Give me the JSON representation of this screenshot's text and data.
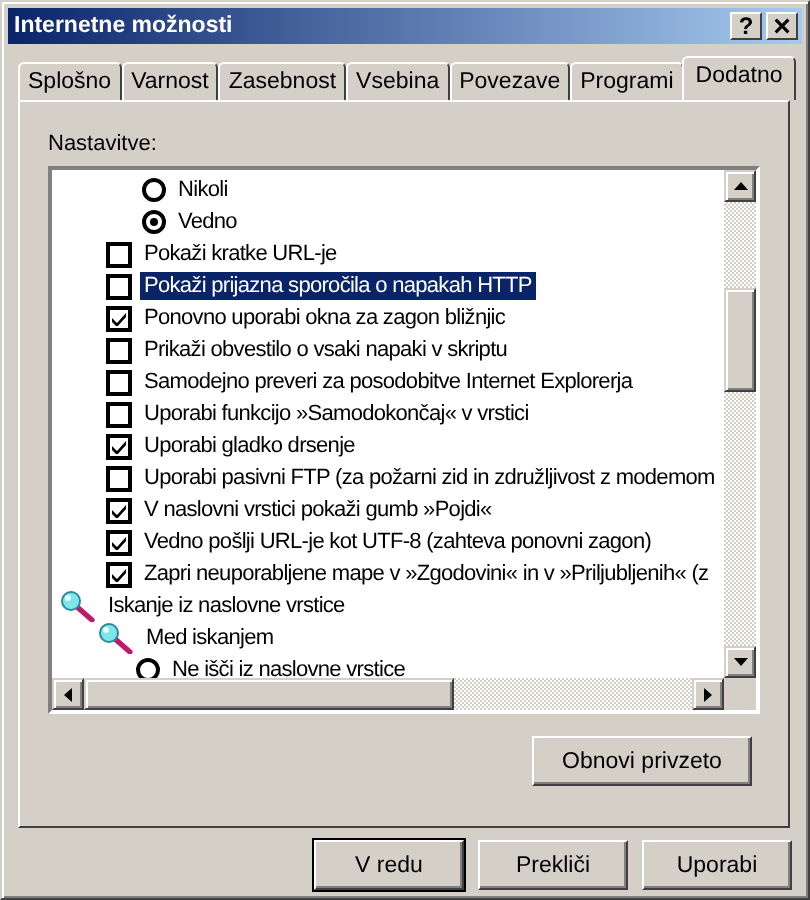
{
  "window": {
    "title": "Internetne možnosti",
    "title_buttons": [
      {
        "kind": "help",
        "label": "?"
      },
      {
        "kind": "close",
        "label": "×"
      }
    ]
  },
  "tabs": [
    {
      "label": "Splošno",
      "selected": false
    },
    {
      "label": "Varnost",
      "selected": false
    },
    {
      "label": "Zasebnost",
      "selected": false
    },
    {
      "label": "Vsebina",
      "selected": false
    },
    {
      "label": "Povezave",
      "selected": false
    },
    {
      "label": "Programi",
      "selected": false
    },
    {
      "label": "Dodatno",
      "selected": true
    }
  ],
  "settings_label": "Nastavitve:",
  "settings": [
    {
      "kind": "radio",
      "label": "Nikoli",
      "checked": false,
      "selected": false
    },
    {
      "kind": "radio",
      "label": "Vedno",
      "checked": true,
      "selected": false
    },
    {
      "kind": "checkbox",
      "label": "Pokaži kratke URL-je",
      "checked": false,
      "selected": false
    },
    {
      "kind": "checkbox",
      "label": "Pokaži prijazna sporočila o napakah HTTP",
      "checked": false,
      "selected": true
    },
    {
      "kind": "checkbox",
      "label": "Ponovno uporabi okna za zagon bližnjic",
      "checked": true,
      "selected": false
    },
    {
      "kind": "checkbox",
      "label": "Prikaži obvestilo o vsaki napaki v skriptu",
      "checked": false,
      "selected": false
    },
    {
      "kind": "checkbox",
      "label": "Samodejno preveri za posodobitve Internet Explorerja",
      "checked": false,
      "selected": false
    },
    {
      "kind": "checkbox",
      "label": "Uporabi funkcijo »Samodokončaj« v vrstici",
      "checked": false,
      "selected": false
    },
    {
      "kind": "checkbox",
      "label": "Uporabi gladko drsenje",
      "checked": true,
      "selected": false
    },
    {
      "kind": "checkbox",
      "label": "Uporabi pasivni FTP (za požarni zid in združljivost z modemom",
      "checked": false,
      "selected": false
    },
    {
      "kind": "checkbox",
      "label": "V naslovni vrstici pokaži gumb »Pojdi«",
      "checked": true,
      "selected": false
    },
    {
      "kind": "checkbox",
      "label": "Vedno pošlji URL-je kot UTF-8 (zahteva ponovni zagon)",
      "checked": true,
      "selected": false
    },
    {
      "kind": "checkbox",
      "label": "Zapri neuporabljene mape v »Zgodovini« in v »Priljubljenih« (z",
      "checked": true,
      "selected": false
    },
    {
      "kind": "group",
      "label": "Iskanje iz naslovne vrstice",
      "selected": false,
      "children": [
        {
          "kind": "group",
          "label": "Med iskanjem",
          "selected": false,
          "children": [
            {
              "kind": "radio",
              "label": "Ne išči iz naslovne vrstice",
              "checked": false,
              "selected": false
            }
          ]
        }
      ]
    }
  ],
  "restore_button": "Obnovi privzeto",
  "buttons": [
    {
      "label": "V redu",
      "default": true
    },
    {
      "label": "Prekliči",
      "default": false
    },
    {
      "label": "Uporabi",
      "default": false
    }
  ]
}
